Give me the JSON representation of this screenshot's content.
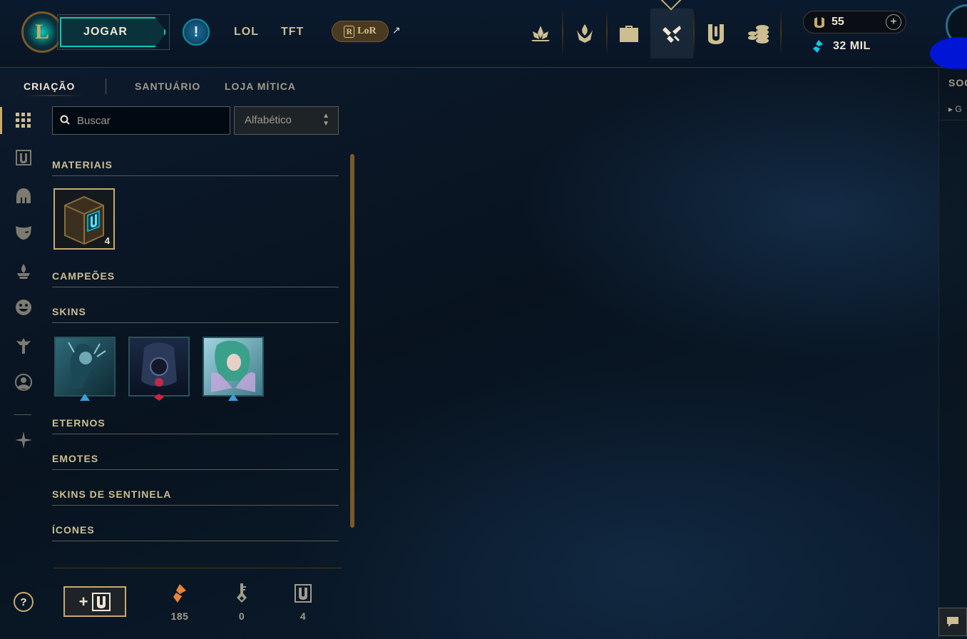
{
  "topbar": {
    "logo_letter": "L",
    "play_label": "JOGAR",
    "alert_label": "!",
    "tabs": [
      {
        "label": "LOL"
      },
      {
        "label": "TFT"
      }
    ],
    "lor_label": "LoR",
    "lor_badge": "R",
    "external_arrow": "↗",
    "nav_icons": [
      "home-lotus-icon",
      "clash-icon",
      "collection-bag-icon",
      "loot-crafting-icon",
      "hextech-icon",
      "store-coins-icon"
    ],
    "active_nav_icon": "loot-crafting-icon"
  },
  "wallet": {
    "rp_value": "55",
    "add_label": "+",
    "blue_essence_value": "32 MIL",
    "rp_color": "#c8aa6e",
    "be_color": "#0ac8e6"
  },
  "subnav": {
    "items": [
      {
        "label": "CRIAÇÃO",
        "active": true
      },
      {
        "label": "SANTUÁRIO",
        "active": false
      },
      {
        "label": "LOJA MÍTICA",
        "active": false
      }
    ]
  },
  "rail": {
    "icons": [
      "grid-icon",
      "chest-icon",
      "helmet-icon",
      "mask-icon",
      "ward-icon",
      "emote-icon",
      "totem-icon",
      "profile-icon"
    ],
    "extra_icon": "compass-icon",
    "help_label": "?"
  },
  "search": {
    "placeholder": "Buscar",
    "value": ""
  },
  "sort": {
    "selected": "Alfabético"
  },
  "categories": [
    {
      "label": "MATERIAIS"
    },
    {
      "label": "CAMPEÕES"
    },
    {
      "label": "SKINS"
    },
    {
      "label": "ETERNOS"
    },
    {
      "label": "EMOTES"
    },
    {
      "label": "SKINS DE SENTINELA"
    },
    {
      "label": "ÍCONES"
    }
  ],
  "materials": [
    {
      "name": "hextech-chest",
      "count": "4"
    }
  ],
  "skins": [
    {
      "name": "skin-shard-1",
      "rarity": "epic",
      "color": "#3aa0d8"
    },
    {
      "name": "skin-shard-2",
      "rarity": "legendary",
      "color": "#d81e3c"
    },
    {
      "name": "skin-shard-3",
      "rarity": "epic",
      "color": "#3aa0d8"
    }
  ],
  "bottom": {
    "craft_plus": "+",
    "resources": [
      {
        "name": "orange-essence-icon",
        "value": "185"
      },
      {
        "name": "key-icon",
        "value": "0"
      },
      {
        "name": "chest-icon",
        "value": "4"
      }
    ]
  },
  "social": {
    "title": "SOC",
    "group_label": "G"
  }
}
